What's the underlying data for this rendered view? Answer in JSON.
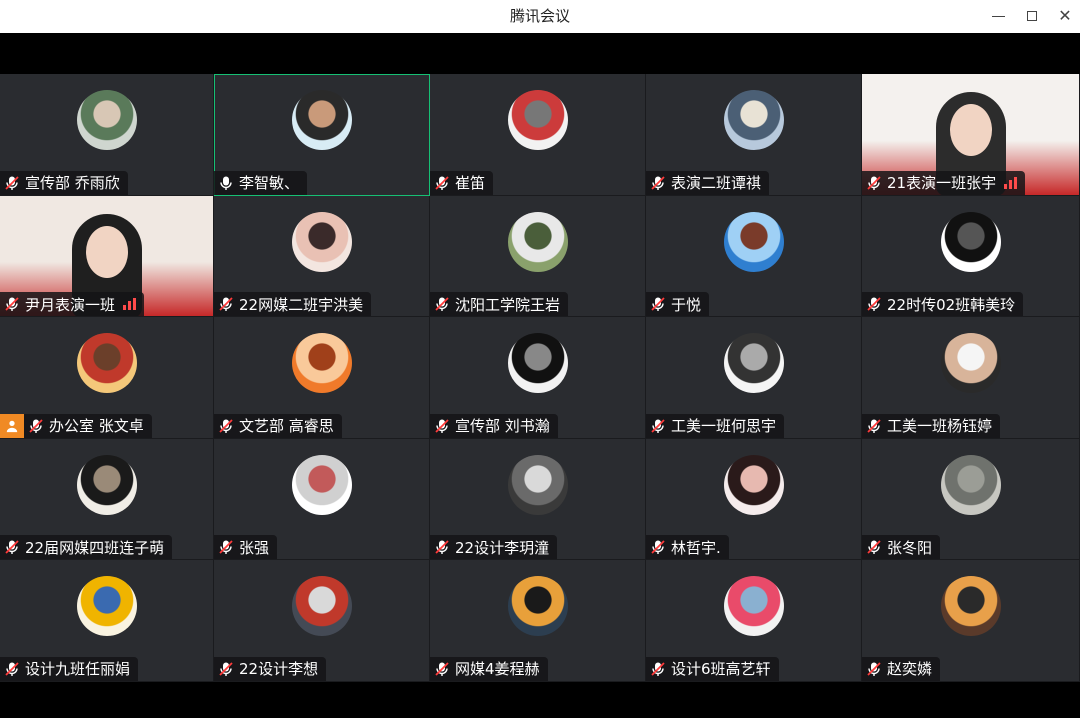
{
  "window": {
    "title": "腾讯会议"
  },
  "participants": [
    {
      "name": "宣传部 乔雨欣",
      "mic": "muted",
      "avatar": "photo-person-outdoor",
      "colors": [
        "#cfd6cf",
        "#5a7a5a",
        "#d8c7b5"
      ]
    },
    {
      "name": "李智敏、",
      "mic": "on",
      "avatar": "photo-older-man",
      "colors": [
        "#d8ecf5",
        "#2a2a2a",
        "#c99a7a"
      ],
      "active": true
    },
    {
      "name": "崔笛",
      "mic": "muted",
      "avatar": "cartoon-drawing",
      "colors": [
        "#f2f2f2",
        "#cc3b3b",
        "#777777"
      ]
    },
    {
      "name": "表演二班谭祺",
      "mic": "muted",
      "avatar": "photo-sea-sky",
      "colors": [
        "#b7c9dc",
        "#4b5f75",
        "#e8e2d5"
      ]
    },
    {
      "name": "21表演一班张宇",
      "mic": "muted",
      "avatar": "video-feed",
      "colors": [
        "#f4f1ee",
        "#c62828",
        "#2c2c2c"
      ],
      "video": true
    },
    {
      "name": "尹月表演一班",
      "mic": "muted",
      "avatar": "video-feed",
      "colors": [
        "#f0e8e2",
        "#c62828",
        "#1f1f1f"
      ],
      "video": true
    },
    {
      "name": "22网媒二班宇洪美",
      "mic": "muted",
      "avatar": "photo-girl",
      "colors": [
        "#f3e6e0",
        "#e9c1b4",
        "#3a2a2a"
      ]
    },
    {
      "name": "沈阳工学院王岩",
      "mic": "muted",
      "avatar": "photo-waterfall",
      "colors": [
        "#8aa16c",
        "#e8e8e8",
        "#4a5e3a"
      ]
    },
    {
      "name": "于悦",
      "mic": "muted",
      "avatar": "photo-blue-sky",
      "colors": [
        "#2f7fd0",
        "#9fd0f5",
        "#7a3b2a"
      ]
    },
    {
      "name": "22时传02班韩美玲",
      "mic": "muted",
      "avatar": "logo-letters",
      "colors": [
        "#ffffff",
        "#111111",
        "#555555"
      ]
    },
    {
      "name": "办公室 张文卓",
      "mic": "muted",
      "avatar": "cartoon-girl",
      "colors": [
        "#f4c87a",
        "#c0392b",
        "#6b3f2a"
      ],
      "badge": true
    },
    {
      "name": "文艺部 高睿思",
      "mic": "muted",
      "avatar": "cartoon-orange",
      "colors": [
        "#f07a2a",
        "#f9c99a",
        "#a0401a"
      ]
    },
    {
      "name": "宣传部 刘书瀚",
      "mic": "muted",
      "avatar": "sketch-boy",
      "colors": [
        "#f2f2f2",
        "#111111",
        "#888888"
      ]
    },
    {
      "name": "工美一班何思宇",
      "mic": "muted",
      "avatar": "sketch-face",
      "colors": [
        "#f5f5f5",
        "#333333",
        "#aaaaaa"
      ]
    },
    {
      "name": "工美一班杨钰婷",
      "mic": "muted",
      "avatar": "photo-boy",
      "colors": [
        "#2a2a2a",
        "#d8b49a",
        "#f5f5f5"
      ]
    },
    {
      "name": "22届网媒四班连子萌",
      "mic": "muted",
      "avatar": "cartoon-panda",
      "colors": [
        "#f0ede6",
        "#1a1a1a",
        "#9a8a78"
      ]
    },
    {
      "name": "张强",
      "mic": "muted",
      "avatar": "photo-cat",
      "colors": [
        "#ffffff",
        "#d0d0d0",
        "#c25a5a"
      ]
    },
    {
      "name": "22设计李玥潼",
      "mic": "muted",
      "avatar": "photo-dark-boy",
      "colors": [
        "#3a3a3a",
        "#6a6a6a",
        "#d9d9d9"
      ]
    },
    {
      "name": "林哲宇.",
      "mic": "muted",
      "avatar": "photo-girl-smile",
      "colors": [
        "#f5ecec",
        "#2a1a1a",
        "#e7b9b0"
      ]
    },
    {
      "name": "张冬阳",
      "mic": "muted",
      "avatar": "photo-turtle",
      "colors": [
        "#c7c7c1",
        "#6f726d",
        "#9b9d96"
      ]
    },
    {
      "name": "设计九班任丽娟",
      "mic": "muted",
      "avatar": "cartoon-girl-mask",
      "colors": [
        "#f9f3e0",
        "#f0b400",
        "#3a6ab0"
      ]
    },
    {
      "name": "22设计李想",
      "mic": "muted",
      "avatar": "photo-crowd",
      "colors": [
        "#444a55",
        "#c0392b",
        "#d9d9d9"
      ]
    },
    {
      "name": "网媒4姜程赫",
      "mic": "muted",
      "avatar": "photo-poster",
      "colors": [
        "#2c3e50",
        "#e8a03a",
        "#1a1a1a"
      ]
    },
    {
      "name": "设计6班高艺轩",
      "mic": "muted",
      "avatar": "photo-hello-kitty",
      "colors": [
        "#f2f2f2",
        "#e94b6a",
        "#8ab0d0"
      ]
    },
    {
      "name": "赵奕嫾",
      "mic": "muted",
      "avatar": "photo-collage",
      "colors": [
        "#5a3a2a",
        "#e8a04a",
        "#2a2a2a"
      ]
    }
  ]
}
